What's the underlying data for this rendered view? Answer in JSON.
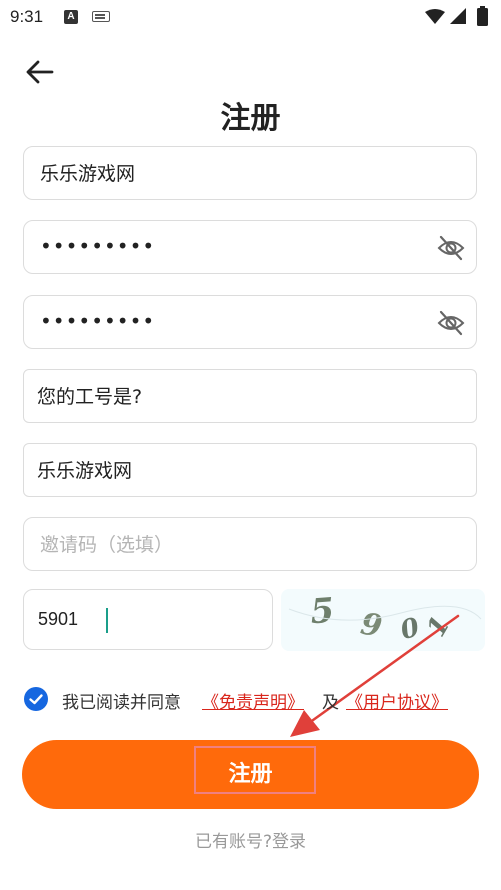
{
  "status_bar": {
    "time": "9:31",
    "notification_icon_letter": "A",
    "icons": [
      "a-notification-icon",
      "keyboard-icon",
      "wifi-icon",
      "signal-icon",
      "battery-icon"
    ]
  },
  "header": {
    "back_icon": "arrow-left-icon",
    "title": "注册"
  },
  "form": {
    "username_value": "乐乐游戏网",
    "password_value": "•••••••••",
    "confirm_password_value": "•••••••••",
    "security_question_value": "您的工号是?",
    "security_answer_value": "乐乐游戏网",
    "invite_code_placeholder": "邀请码（选填）",
    "captcha_input_value": "5901",
    "captcha_image_text": "5901",
    "eye_icon": "eye-off-icon"
  },
  "agreement": {
    "checked": true,
    "text_prefix": "我已阅读并同意",
    "disclaimer_link": "《免责声明》",
    "joiner": "及",
    "user_agreement_link": "《用户协议》"
  },
  "register_button_label": "注册",
  "login_prompt": {
    "question": "已有账号?",
    "link": "登录"
  },
  "colors": {
    "accent_orange": "#ff6a0b",
    "checkbox_blue": "#1667e0",
    "link_red": "#d9261c",
    "annotation_red": "#e0403a"
  }
}
